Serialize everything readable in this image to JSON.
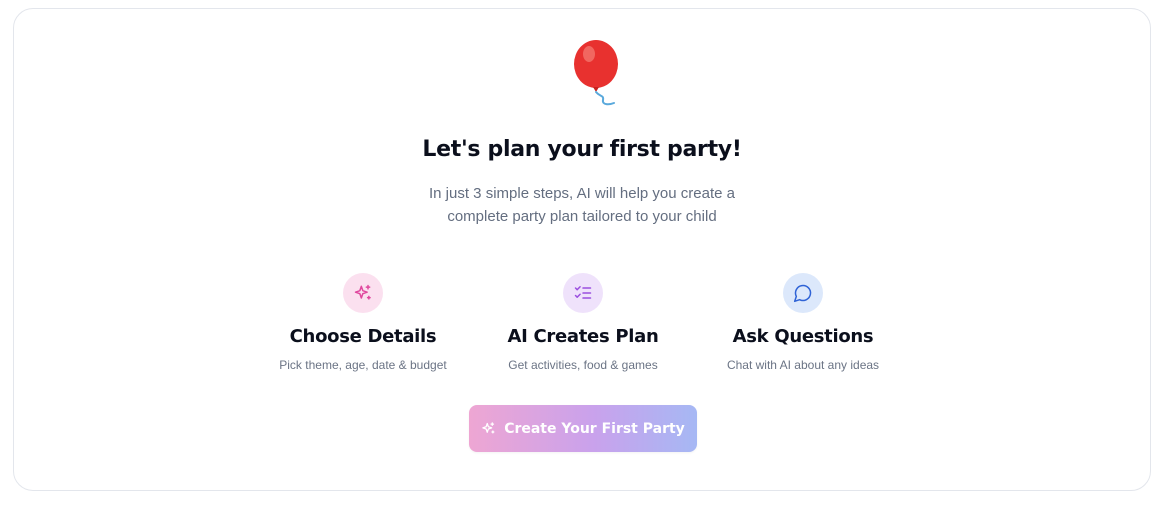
{
  "hero": {
    "icon": "balloon-icon",
    "title": "Let's plan your first party!",
    "subtitle_line1": "In just 3 simple steps, AI will help you create a",
    "subtitle_line2": "complete party plan tailored to your child"
  },
  "steps": [
    {
      "icon": "sparkles-icon",
      "icon_bg": "#fbe0ef",
      "icon_color": "#e0479e",
      "title": "Choose Details",
      "description": "Pick theme, age, date & budget"
    },
    {
      "icon": "list-checks-icon",
      "icon_bg": "#efe2fb",
      "icon_color": "#9b4fe0",
      "title": "AI Creates Plan",
      "description": "Get activities, food & games"
    },
    {
      "icon": "message-circle-icon",
      "icon_bg": "#dce8fb",
      "icon_color": "#2f63d6",
      "title": "Ask Questions",
      "description": "Chat with AI about any ideas"
    }
  ],
  "cta": {
    "icon": "sparkles-icon",
    "label": "Create Your First Party",
    "gradient": [
      "#eea6d3",
      "#c9a2ec",
      "#a6b8f4"
    ]
  }
}
